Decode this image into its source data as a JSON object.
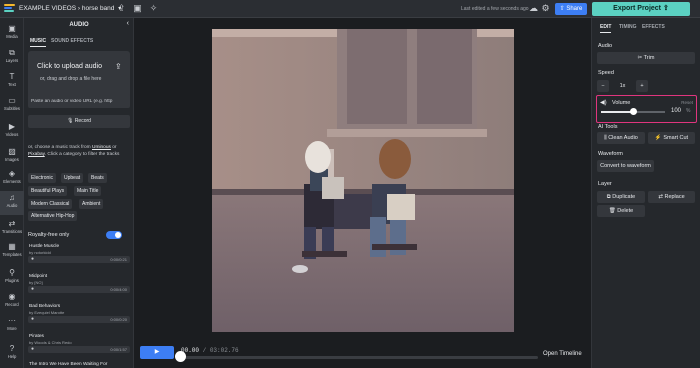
{
  "app": {
    "project_path": "EXAMPLE VIDEOS",
    "project_name": "horse band",
    "last_edited": "Last edited a few seconds ago",
    "share_label": "Share",
    "export_label": "Export Project",
    "logo_colors": [
      "#f5b82e",
      "#3d7ef4",
      "#5bd1c2"
    ]
  },
  "nav": [
    {
      "label": "Media",
      "icon": "folder-icon",
      "glyph": "▣"
    },
    {
      "label": "Layers",
      "icon": "layers-icon",
      "glyph": "⧉"
    },
    {
      "label": "Text",
      "icon": "text-icon",
      "glyph": "T"
    },
    {
      "label": "Subtitles",
      "icon": "subtitles-icon",
      "glyph": "▭"
    },
    {
      "label": "Videos",
      "icon": "video-icon",
      "glyph": "▶"
    },
    {
      "label": "Images",
      "icon": "image-icon",
      "glyph": "▨"
    },
    {
      "label": "Elements",
      "icon": "elements-icon",
      "glyph": "◈"
    },
    {
      "label": "Audio",
      "icon": "music-icon",
      "glyph": "♫"
    },
    {
      "label": "Transitions",
      "icon": "transitions-icon",
      "glyph": "⇄"
    },
    {
      "label": "Templates",
      "icon": "templates-icon",
      "glyph": "▦"
    },
    {
      "label": "Plugins",
      "icon": "plugins-icon",
      "glyph": "⚲"
    },
    {
      "label": "Record",
      "icon": "record-icon",
      "glyph": "◉"
    },
    {
      "label": "More",
      "icon": "more-icon",
      "glyph": "···"
    },
    {
      "label": "Help",
      "icon": "help-icon",
      "glyph": "?"
    }
  ],
  "audio_panel": {
    "title": "AUDIO",
    "tabs": [
      "MUSIC",
      "SOUND EFFECTS"
    ],
    "upload_main": "Click to upload audio",
    "upload_sub": "or, drag and drop a file here",
    "url_placeholder": "Paste an audio or video URL (e.g. http",
    "record_label": "Record",
    "info_pre": "or, choose a music track from ",
    "info_link1": "Uminous",
    "info_mid": " or ",
    "info_link2": "Pixabay",
    "info_post": ". Click a category to filter the tracks",
    "categories": [
      "Electronic",
      "Upbeat",
      "Beats",
      "Beautiful Plays",
      "Main Title",
      "Modern Classical",
      "Ambient",
      "Alternative Hip-Hop"
    ],
    "royalty_label": "Royalty-free only",
    "tracks": [
      {
        "title": "Hustle Muscle",
        "artist": "by notorkidd",
        "duration": "0:00/0:21"
      },
      {
        "title": "Midpoint",
        "artist": "by [NO]",
        "duration": "0:00/4:00"
      },
      {
        "title": "Bad Behaviors",
        "artist": "by Ezequiel Marotte",
        "duration": "0:00/0:20"
      },
      {
        "title": "Pirates",
        "artist": "by Woods & Chris Redo",
        "duration": "0:00/1:57"
      }
    ],
    "footer_track": "The Intro We Have Been Waiting For"
  },
  "player": {
    "current": "00.00",
    "sep": " / ",
    "total": "03:02.76",
    "open_timeline": "Open Timeline",
    "progress": 0
  },
  "right_panel": {
    "tabs": [
      "EDIT",
      "TIMING",
      "EFFECTS"
    ],
    "audio_section": "Audio",
    "trim_label": "Trim",
    "speed_section": "Speed",
    "speed_value": "1x",
    "volume_label": "Volume",
    "volume_reset": "Reset",
    "volume_value": "100",
    "volume_unit": "%",
    "volume_level": 0.5,
    "ai_section": "AI Tools",
    "clean_audio": "Clean Audio",
    "smart_cut": "Smart Cut",
    "waveform_section": "Waveform",
    "convert_waveform": "Convert to waveform",
    "layer_section": "Layer",
    "duplicate": "Duplicate",
    "replace": "Replace",
    "delete": "Delete"
  }
}
